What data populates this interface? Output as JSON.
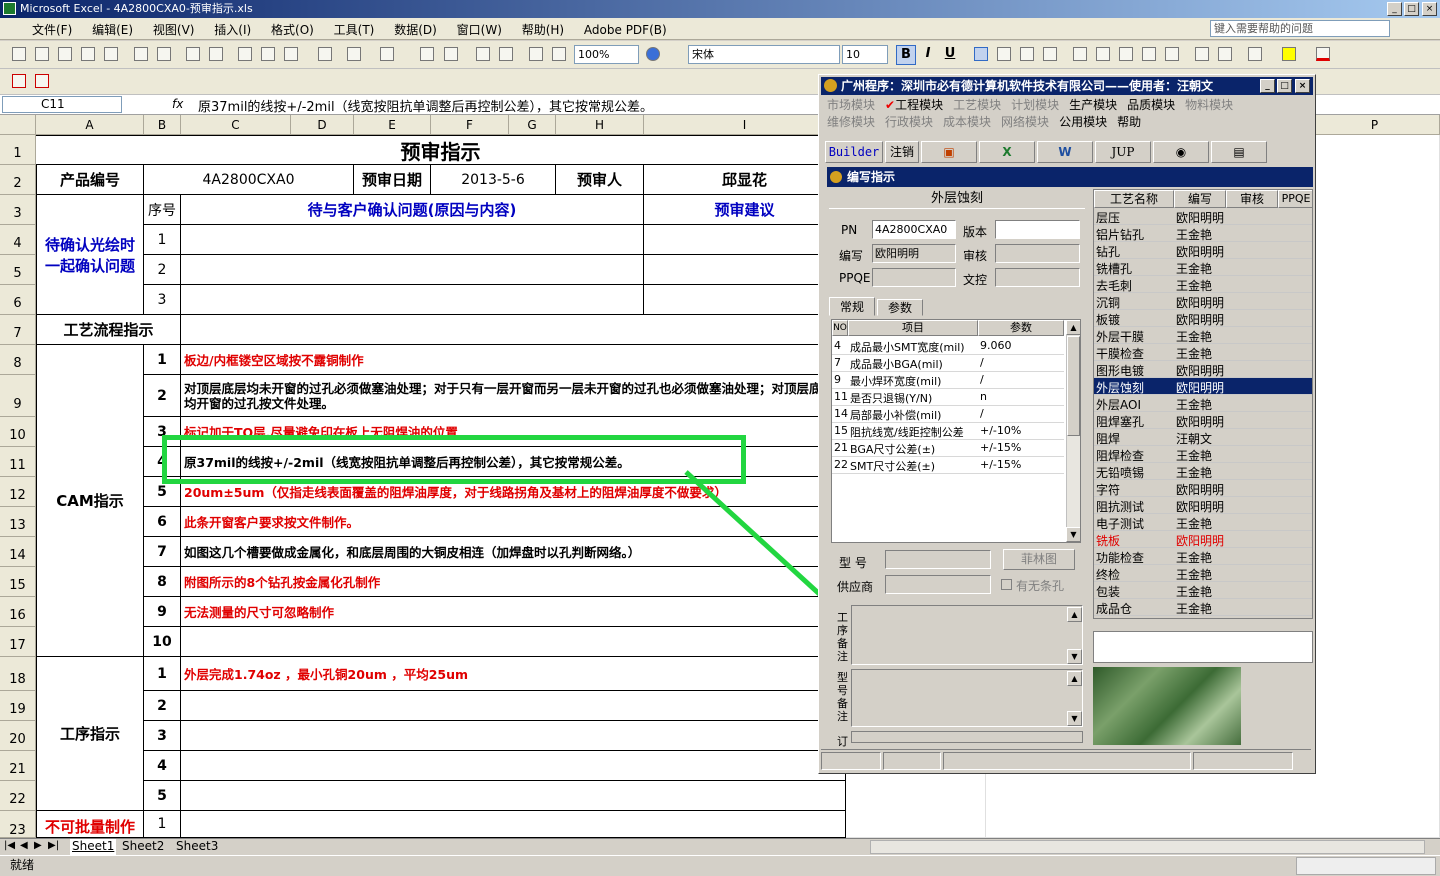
{
  "window": {
    "title": "Microsoft Excel - 4A2800CXA0-预审指示.xls"
  },
  "menu": {
    "items": [
      "文件(F)",
      "编辑(E)",
      "视图(V)",
      "插入(I)",
      "格式(O)",
      "工具(T)",
      "数据(D)",
      "窗口(W)",
      "帮助(H)",
      "Adobe PDF(B)"
    ],
    "help_placeholder": "键入需要帮助的问题"
  },
  "toolbar": {
    "zoom": "100%",
    "font": "宋体",
    "font_size": "10"
  },
  "formula_bar": {
    "cell_ref": "C11",
    "fx": "fx",
    "content": "原37mil的线按+/-2mil（线宽按阻抗单调整后再控制公差），其它按常规公差。"
  },
  "columns": [
    "A",
    "B",
    "C",
    "D",
    "E",
    "F",
    "G",
    "H",
    "I",
    "P"
  ],
  "rows": [
    "1",
    "2",
    "3",
    "4",
    "5",
    "6",
    "7",
    "8",
    "9",
    "10",
    "11",
    "12",
    "13",
    "14",
    "15",
    "16",
    "17",
    "18",
    "19",
    "20",
    "21",
    "22",
    "23"
  ],
  "sheet": {
    "title": "预审指示",
    "product_no_label": "产品编号",
    "product_no": "4A2800CXA0",
    "review_date_label": "预审日期",
    "review_date": "2013-5-6",
    "reviewer_label": "预审人",
    "reviewer": "邱显花",
    "seq_label": "序号",
    "issue_label": "待与客户确认问题(原因与内容)",
    "suggest_label": "预审建议",
    "confirm_label": "待确认光绘时一起确认问题",
    "confirm_nums": [
      "1",
      "2",
      "3"
    ],
    "process_label": "工艺流程指示",
    "cam_label": "CAM指示",
    "cam_items": [
      {
        "n": "1",
        "text": "板边/内框镂空区域按不露铜制作",
        "color": "red"
      },
      {
        "n": "2",
        "text": "对顶层底层均未开窗的过孔必须做塞油处理；对于只有一层开窗而另一层未开窗的过孔也必须做塞油处理；对顶层底层均开窗的过孔按文件处理。",
        "color": "black"
      },
      {
        "n": "3",
        "text": "标记加于TO层,尽量避免印在板上无阻焊油的位置",
        "color": "red"
      },
      {
        "n": "4",
        "text": "原37mil的线按+/-2mil（线宽按阻抗单调整后再控制公差），其它按常规公差。",
        "color": "black"
      },
      {
        "n": "5",
        "text": "20um±5um（仅指走线表面覆盖的阻焊油厚度，对于线路拐角及基材上的阻焊油厚度不做要求）",
        "color": "red"
      },
      {
        "n": "6",
        "text": "此条开窗客户要求按文件制作。",
        "color": "red"
      },
      {
        "n": "7",
        "text": "如图这几个槽要做成金属化，和底层周围的大铜皮相连（加焊盘时以孔判断网络。）",
        "color": "black"
      },
      {
        "n": "8",
        "text": "附图所示的8个钻孔按金属化孔制作",
        "color": "red"
      },
      {
        "n": "9",
        "text": "无法测量的尺寸可忽略制作",
        "color": "red"
      },
      {
        "n": "10",
        "text": "",
        "color": "black"
      }
    ],
    "proc_label": "工序指示",
    "proc_items": [
      {
        "n": "1",
        "text": "外层完成1.74oz ，最小孔铜20um ，平均25um",
        "color": "red"
      },
      {
        "n": "2",
        "text": "",
        "color": "black"
      },
      {
        "n": "3",
        "text": "",
        "color": "black"
      },
      {
        "n": "4",
        "text": "",
        "color": "black"
      },
      {
        "n": "5",
        "text": "",
        "color": "black"
      }
    ],
    "batch_label": "不可批量制作",
    "batch_num": "1"
  },
  "sheet_tabs": [
    "Sheet1",
    "Sheet2",
    "Sheet3"
  ],
  "status": "就绪",
  "dialog": {
    "title": "广州程序：深圳市必有德计算机软件技术有限公司——使用者：汪朝文",
    "menu_row1": [
      "市场模块",
      "工程模块",
      "工艺模块",
      "计划模块",
      "生产模块",
      "品质模块",
      "物料模块"
    ],
    "menu_row2": [
      "维修模块",
      "行政模块",
      "成本模块",
      "网络模块",
      "公用模块",
      "帮助"
    ],
    "toolbar": [
      "Builder",
      "注销",
      "JUP"
    ],
    "subwindow_title": "编写指示",
    "section_title": "外层蚀刻",
    "pn_label": "PN",
    "pn_value": "4A2800CXA0",
    "version_label": "版本",
    "editor_label": "编写",
    "editor_value": "欧阳明明",
    "reviewer_label": "审核",
    "ppqe_label": "PPQE",
    "doc_label": "文控",
    "tabs": [
      "常规",
      "参数"
    ],
    "table_headers": [
      "NO",
      "项目",
      "参数"
    ],
    "table_rows": [
      {
        "no": "4",
        "item": "成品最小SMT宽度(mil)",
        "param": "9.060"
      },
      {
        "no": "7",
        "item": "成品最小BGA(mil)",
        "param": "/"
      },
      {
        "no": "9",
        "item": "最小焊环宽度(mil)",
        "param": "/"
      },
      {
        "no": "11",
        "item": "是否只退锡(Y/N)",
        "param": "n"
      },
      {
        "no": "14",
        "item": "局部最小补偿(mil)",
        "param": "/"
      },
      {
        "no": "15",
        "item": "阻抗线宽/线距控制公差",
        "param": "+/-10%"
      },
      {
        "no": "21",
        "item": "BGA尺寸公差(±)",
        "param": "+/-15%"
      },
      {
        "no": "22",
        "item": "SMT尺寸公差(±)",
        "param": "+/-15%"
      }
    ],
    "model_label": "型 号",
    "film_button": "菲林图",
    "supplier_label": "供应商",
    "no_hole_label": "有无条孔",
    "process_note_label": "工序备注",
    "model_note_label": "型号备注",
    "order_label": "订",
    "right_headers": [
      "工艺名称",
      "编写",
      "审核",
      "PPQE"
    ],
    "right_rows": [
      {
        "name": "层压",
        "editor": "欧阳明明",
        "state": "normal"
      },
      {
        "name": "铝片钻孔",
        "editor": "王金艳",
        "state": "normal"
      },
      {
        "name": "钻孔",
        "editor": "欧阳明明",
        "state": "normal"
      },
      {
        "name": "铣槽孔",
        "editor": "王金艳",
        "state": "normal"
      },
      {
        "name": "去毛刺",
        "editor": "王金艳",
        "state": "normal"
      },
      {
        "name": "沉铜",
        "editor": "欧阳明明",
        "state": "normal"
      },
      {
        "name": "板镀",
        "editor": "欧阳明明",
        "state": "normal"
      },
      {
        "name": "外层干膜",
        "editor": "王金艳",
        "state": "normal"
      },
      {
        "name": "干膜检查",
        "editor": "王金艳",
        "state": "normal"
      },
      {
        "name": "图形电镀",
        "editor": "欧阳明明",
        "state": "normal"
      },
      {
        "name": "外层蚀刻",
        "editor": "欧阳明明",
        "state": "selected"
      },
      {
        "name": "外层AOI",
        "editor": "王金艳",
        "state": "normal"
      },
      {
        "name": "阻焊塞孔",
        "editor": "欧阳明明",
        "state": "normal"
      },
      {
        "name": "阻焊",
        "editor": "汪朝文",
        "state": "normal"
      },
      {
        "name": "阻焊检查",
        "editor": "王金艳",
        "state": "normal"
      },
      {
        "name": "无铅喷锡",
        "editor": "王金艳",
        "state": "normal"
      },
      {
        "name": "字符",
        "editor": "欧阳明明",
        "state": "normal"
      },
      {
        "name": "阻抗测试",
        "editor": "欧阳明明",
        "state": "normal"
      },
      {
        "name": "电子测试",
        "editor": "王金艳",
        "state": "normal"
      },
      {
        "name": "铣板",
        "editor": "欧阳明明",
        "state": "red"
      },
      {
        "name": "功能检查",
        "editor": "王金艳",
        "state": "normal"
      },
      {
        "name": "终检",
        "editor": "王金艳",
        "state": "normal"
      },
      {
        "name": "包装",
        "editor": "王金艳",
        "state": "normal"
      },
      {
        "name": "成品仓",
        "editor": "王金艳",
        "state": "normal"
      }
    ]
  }
}
